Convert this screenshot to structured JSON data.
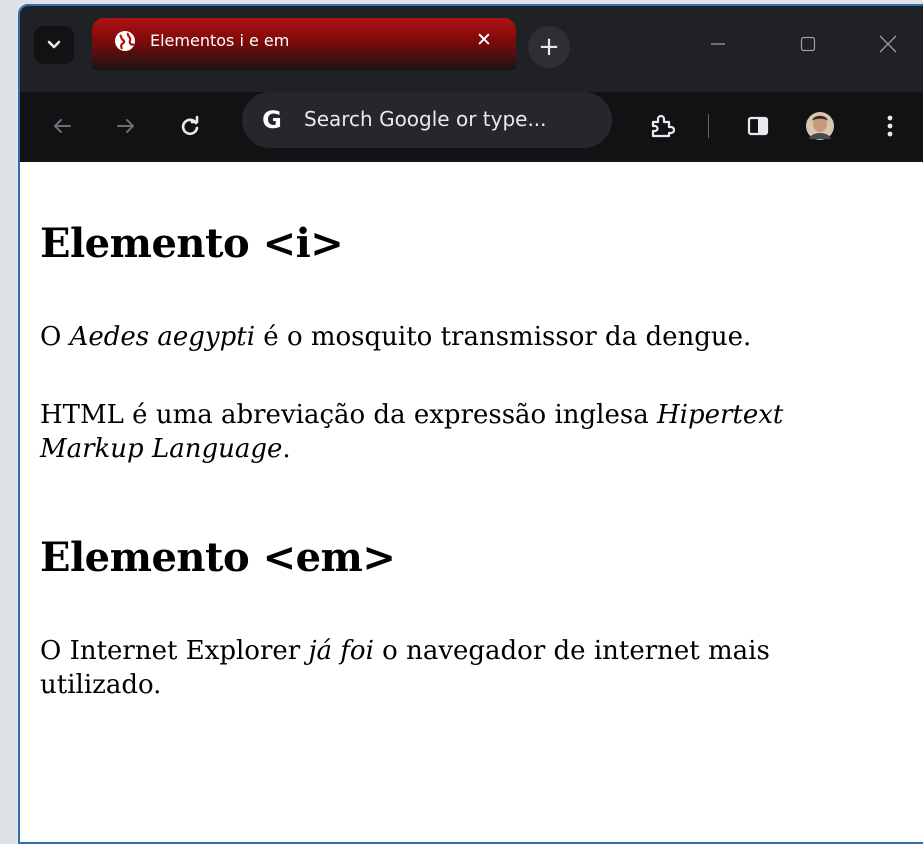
{
  "browser": {
    "tab_title": "Elementos i e em",
    "tab_close_glyph": "✕",
    "new_tab_glyph": "+",
    "omnibox_placeholder": "Search Google or type...",
    "omnibox_logo": "G",
    "accent_tab_color": "#b01212",
    "frame_color": "#202124",
    "toolbar_color": "#111214"
  },
  "page": {
    "sections": [
      {
        "heading": "Elemento <i>",
        "paragraphs": [
          {
            "before": "O ",
            "italic": "Aedes aegypti",
            "after": " é o mosquito transmissor da dengue."
          },
          {
            "before": "HTML é uma abreviação da expressão inglesa ",
            "italic": "Hipertext Markup Language",
            "after": "."
          }
        ]
      },
      {
        "heading": "Elemento <em>",
        "paragraphs": [
          {
            "before": "O Internet Explorer ",
            "italic": "já foi",
            "after": " o navegador de internet mais utilizado."
          }
        ]
      }
    ]
  }
}
